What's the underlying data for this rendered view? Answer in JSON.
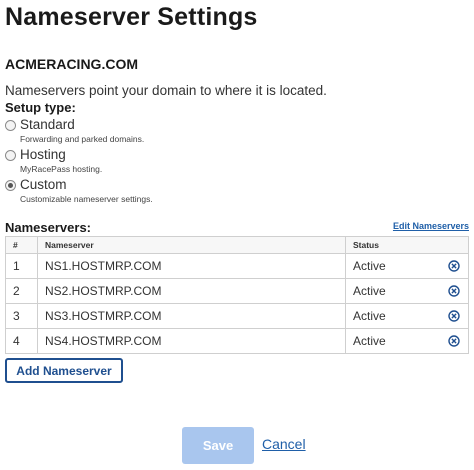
{
  "page": {
    "title": "Nameserver Settings",
    "domain": "ACMERACING.COM",
    "description": "Nameservers point your domain to where it is located.",
    "setup_type_label": "Setup type:"
  },
  "setup_options": [
    {
      "label": "Standard",
      "sub": "Forwarding and parked domains.",
      "checked": false
    },
    {
      "label": "Hosting",
      "sub": "MyRacePass hosting.",
      "checked": false
    },
    {
      "label": "Custom",
      "sub": "Customizable nameserver settings.",
      "checked": true
    }
  ],
  "nameservers": {
    "label": "Nameservers:",
    "edit_link": "Edit Nameservers",
    "columns": [
      "#",
      "Nameserver",
      "Status"
    ],
    "rows": [
      {
        "num": "1",
        "name": "NS1.HOSTMRP.COM",
        "status": "Active"
      },
      {
        "num": "2",
        "name": "NS2.HOSTMRP.COM",
        "status": "Active"
      },
      {
        "num": "3",
        "name": "NS3.HOSTMRP.COM",
        "status": "Active"
      },
      {
        "num": "4",
        "name": "NS4.HOSTMRP.COM",
        "status": "Active"
      }
    ],
    "add_button": "Add Nameserver"
  },
  "actions": {
    "save": "Save",
    "cancel": "Cancel"
  },
  "icons": {
    "remove": "remove-circle-icon"
  },
  "colors": {
    "link": "#1f5fa8",
    "add_button_border": "#1f4f8f",
    "save_disabled_bg": "#a9c6ee",
    "remove_icon": "#1f4f8f"
  }
}
